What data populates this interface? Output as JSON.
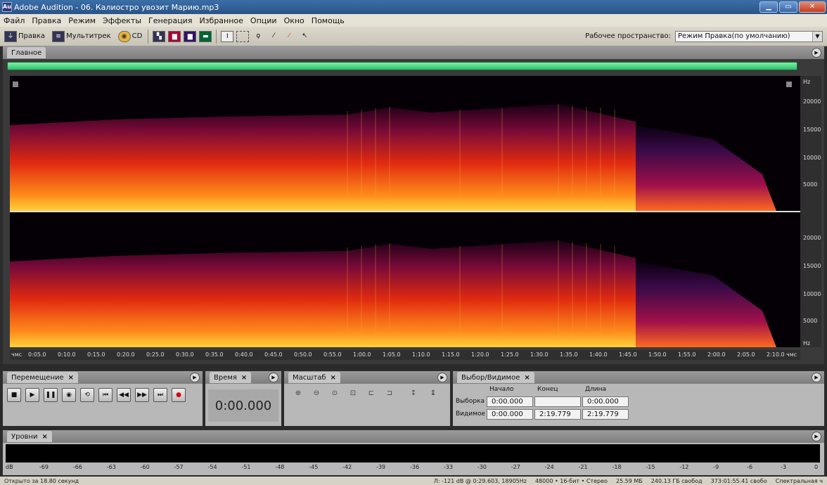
{
  "window": {
    "app_icon": "Au",
    "title": "Adobe Audition - 06. Калиостро увозит Марию.mp3"
  },
  "menu": [
    "Файл",
    "Правка",
    "Режим",
    "Эффекты",
    "Генерация",
    "Избранное",
    "Опции",
    "Окно",
    "Помощь"
  ],
  "toolbar": {
    "edit_label": "Правка",
    "multitrack_label": "Мультитрек",
    "cd_label": "CD",
    "workspace_label": "Рабочее пространство:",
    "workspace_value": "Режим Правка(по умолчанию)"
  },
  "main_panel": {
    "tab_label": "Главное"
  },
  "freq_axis": {
    "unit": "Hz",
    "ticks": [
      "20000",
      "15000",
      "10000",
      "5000"
    ],
    "bottom_unit": "Hz"
  },
  "time_axis": {
    "start_label": "чмс",
    "end_label": "чмс",
    "ticks": [
      "0:05.0",
      "0:10.0",
      "0:15.0",
      "0:20.0",
      "0:25.0",
      "0:30.0",
      "0:35.0",
      "0:40.0",
      "0:45.0",
      "0:50.0",
      "0:55.0",
      "1:00.0",
      "1:05.0",
      "1:10.0",
      "1:15.0",
      "1:20.0",
      "1:25.0",
      "1:30.0",
      "1:35.0",
      "1:40.0",
      "1:45.0",
      "1:50.0",
      "1:55.0",
      "2:00.0",
      "2:05.0",
      "2:10.0",
      "2:15.0"
    ]
  },
  "transport": {
    "tab_label": "Перемещение"
  },
  "time_panel": {
    "tab_label": "Время",
    "value": "0:00.000"
  },
  "zoom_panel": {
    "tab_label": "Масштаб"
  },
  "selection": {
    "tab_label": "Выбор/Видимое",
    "col_start": "Начало",
    "col_end": "Конец",
    "col_length": "Длина",
    "row_selection": "Выборка",
    "row_view": "Видимое",
    "sel_start": "0:00.000",
    "sel_end": "",
    "sel_length": "0:00.000",
    "view_start": "0:00.000",
    "view_end": "2:19.779",
    "view_length": "2:19.779"
  },
  "levels": {
    "tab_label": "Уровни",
    "scale": [
      "dB",
      "-69",
      "-66",
      "-63",
      "-60",
      "-57",
      "-54",
      "-51",
      "-48",
      "-45",
      "-42",
      "-39",
      "-36",
      "-33",
      "-30",
      "-27",
      "-24",
      "-21",
      "-18",
      "-15",
      "-12",
      "-9",
      "-6",
      "-3",
      "0"
    ]
  },
  "status": {
    "opened": "Открыто за 18.80 секунд",
    "cursor": "Л: -121 dB @  0:29.603, 18905Hz",
    "format": "48000 • 16-бит • Стерео",
    "size": "25.59 МБ",
    "free": "240.13 ГБ свобод",
    "time_free": "373:01:55.41 свобо",
    "mode": "Спектральная ч"
  }
}
